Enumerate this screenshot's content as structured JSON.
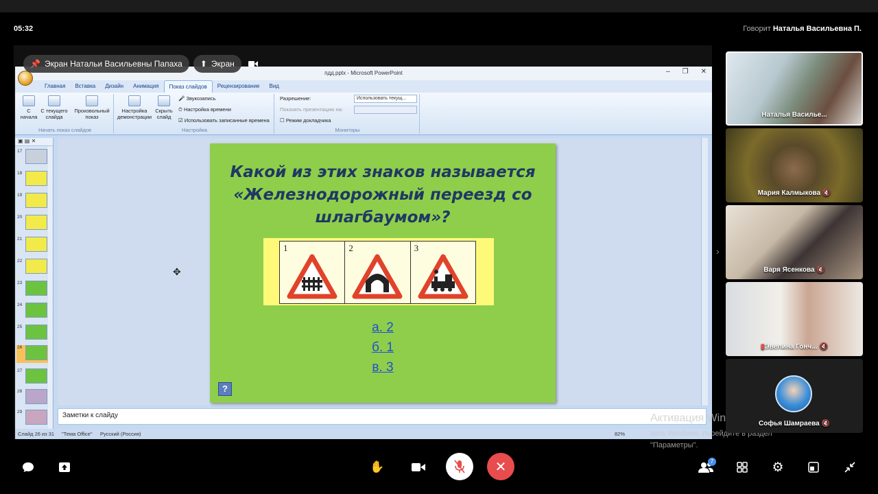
{
  "meeting": {
    "time": "05:32",
    "speaking_label": "Говорит",
    "speaking_name": "Наталья Васильевна П."
  },
  "share": {
    "badge_label": "Экран Натальи Васильевны Папаха",
    "screen_button": "Экран"
  },
  "ppt": {
    "window_title": "пдд.pptx - Microsoft PowerPoint",
    "tabs": [
      "Главная",
      "Вставка",
      "Дизайн",
      "Анимация",
      "Показ слайдов",
      "Рецензирование",
      "Вид"
    ],
    "ribbon": {
      "btn_from_start": "С начала",
      "btn_from_current": "С текущего слайда",
      "btn_custom": "Произвольный показ",
      "group_start": "Начать показ слайдов",
      "btn_setup": "Настройка демонстрации",
      "btn_hide": "Скрыть слайд",
      "rec_narration": "Звукозапись",
      "rehearse": "Настройка времени",
      "use_timings": "Использовать записанные времена",
      "group_setup": "Настройка",
      "resolution_label": "Разрешение:",
      "resolution_value": "Использовать текущ...",
      "show_on_label": "Показать презентацию на:",
      "presenter_view": "Режим докладчика",
      "group_monitors": "Мониторы"
    },
    "thumbnails": [
      "17",
      "18",
      "19",
      "20",
      "21",
      "22",
      "23",
      "24",
      "25",
      "26",
      "27",
      "28",
      "29"
    ],
    "notes_placeholder": "Заметки к слайду",
    "status_slide": "Слайд 26 из 31",
    "status_theme": "\"Тема Office\"",
    "status_lang": "Русский (Россия)",
    "zoom": "82%"
  },
  "slide": {
    "question_line1": "Какой из этих знаков называется",
    "question_line2": "«Железнодорожный переезд со",
    "question_line3": "шлагбаумом»?",
    "sign_numbers": [
      "1",
      "2",
      "3"
    ],
    "answers": [
      "а. 2",
      "б. 1",
      "в. 3"
    ],
    "help": "?"
  },
  "windows_activation": {
    "title": "Активация Windows",
    "line1": "вать Windows, перейдите в раздел",
    "line2": "\"Параметры\"."
  },
  "participants": [
    {
      "name": "Наталья Василье..."
    },
    {
      "name": "Мария Калмыкова"
    },
    {
      "name": "Варя Ясенкова"
    },
    {
      "name": "Эвелина Гонч..."
    },
    {
      "name": "Софья Шамраева"
    }
  ],
  "participants_count": "7",
  "colors": {
    "slide_bg": "#8fce4a",
    "question_text": "#1f3864",
    "answer_link": "#1f4fd0",
    "hangup": "#e84c4c"
  }
}
